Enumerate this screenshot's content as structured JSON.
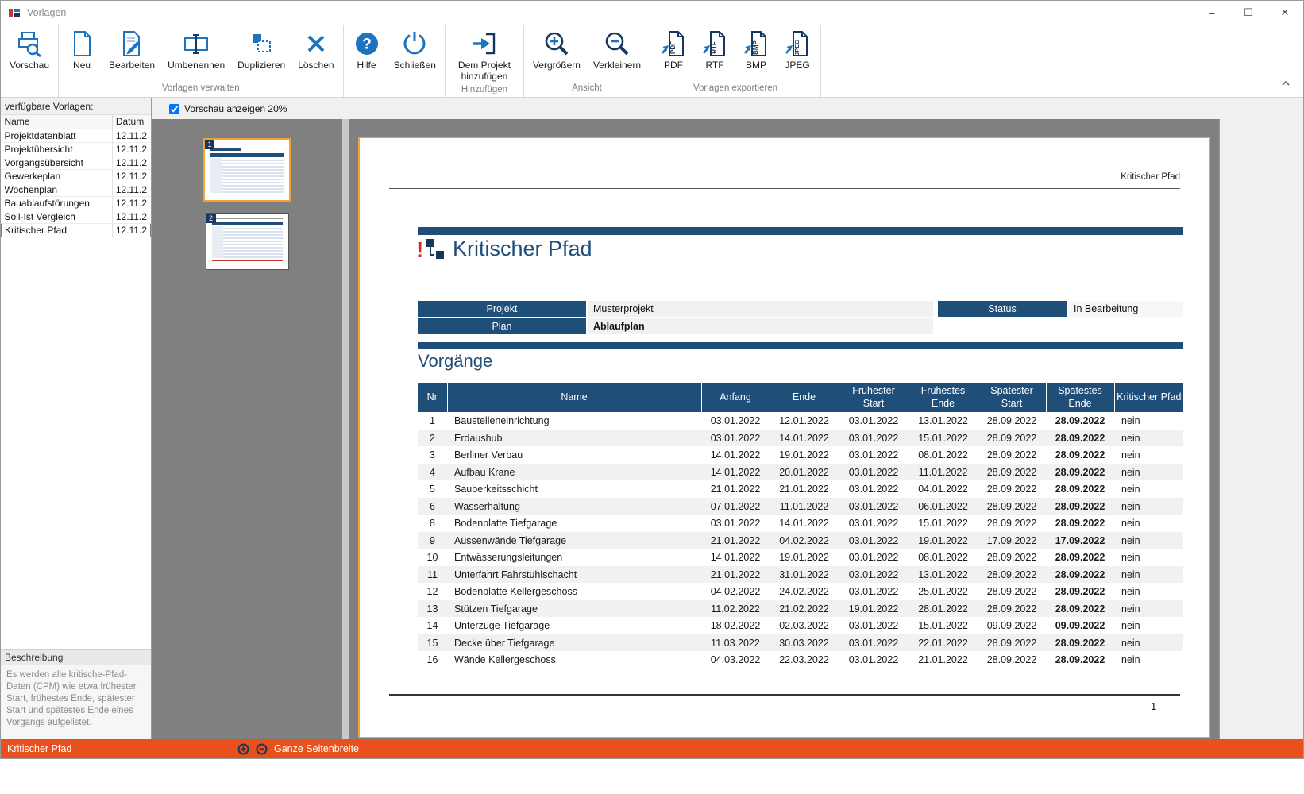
{
  "window": {
    "title": "Vorlagen",
    "minimize": "–",
    "maximize": "☐",
    "close": "✕"
  },
  "ribbon": {
    "labels": {
      "vorschau": "Vorschau",
      "neu": "Neu",
      "bearbeiten": "Bearbeiten",
      "umbenennen": "Umbenennen",
      "duplizieren": "Duplizieren",
      "loeschen": "Löschen",
      "hilfe": "Hilfe",
      "schliessen": "Schließen",
      "projekt_hinzufuegen": "Dem Projekt hinzufügen",
      "vergroessern": "Vergrößern",
      "verkleinern": "Verkleinern",
      "pdf": "PDF",
      "rtf": "RTF",
      "bmp": "BMP",
      "jpeg": "JPEG"
    },
    "groups": {
      "verwalten": "Vorlagen verwalten",
      "hinzufuegen": "Hinzufügen",
      "ansicht": "Ansicht",
      "exportieren": "Vorlagen exportieren"
    }
  },
  "sidebar": {
    "header": "verfügbare Vorlagen:",
    "col_name": "Name",
    "col_datum": "Datum",
    "items": [
      {
        "name": "Projektdatenblatt",
        "datum": "12.11.2"
      },
      {
        "name": "Projektübersicht",
        "datum": "12.11.2"
      },
      {
        "name": "Vorgangsübersicht",
        "datum": "12.11.2"
      },
      {
        "name": "Gewerkeplan",
        "datum": "12.11.2"
      },
      {
        "name": "Wochenplan",
        "datum": "12.11.2"
      },
      {
        "name": "Bauablaufstörungen",
        "datum": "12.11.2"
      },
      {
        "name": "Soll-Ist Vergleich",
        "datum": "12.11.2"
      },
      {
        "name": "Kritischer Pfad",
        "datum": "12.11.2",
        "selected": true
      }
    ],
    "description_header": "Beschreibung",
    "description": "Es werden alle kritische-Pfad-Daten (CPM) wie etwa frühester Start, frühestes Ende, spätester Start und spätestes Ende eines Vorgangs aufgelistet."
  },
  "preview_toolbar": {
    "checkbox_label": "Vorschau anzeigen 20%"
  },
  "thumbnails": [
    {
      "page": "1",
      "selected": true
    },
    {
      "page": "2",
      "selected": false
    }
  ],
  "report": {
    "header_right": "Kritischer Pfad",
    "title": "Kritischer Pfad",
    "info": {
      "projekt_label": "Projekt",
      "projekt_value": "Musterprojekt",
      "status_label": "Status",
      "status_value": "In Bearbeitung",
      "plan_label": "Plan",
      "plan_value": "Ablaufplan"
    },
    "section_title": "Vorgänge",
    "table": {
      "headers": [
        "Nr",
        "Name",
        "Anfang",
        "Ende",
        "Frühester Start",
        "Frühestes Ende",
        "Spätester Start",
        "Spätestes Ende",
        "Kritischer Pfad"
      ],
      "rows": [
        {
          "nr": "1",
          "name": "Baustelleneinrichtung",
          "anfang": "03.01.2022",
          "ende": "12.01.2022",
          "fr_start": "03.01.2022",
          "fr_ende": "13.01.2022",
          "sp_start": "28.09.2022",
          "sp_ende": "28.09.2022",
          "kritisch": "nein"
        },
        {
          "nr": "2",
          "name": "Erdaushub",
          "anfang": "03.01.2022",
          "ende": "14.01.2022",
          "fr_start": "03.01.2022",
          "fr_ende": "15.01.2022",
          "sp_start": "28.09.2022",
          "sp_ende": "28.09.2022",
          "kritisch": "nein"
        },
        {
          "nr": "3",
          "name": "Berliner Verbau",
          "anfang": "14.01.2022",
          "ende": "19.01.2022",
          "fr_start": "03.01.2022",
          "fr_ende": "08.01.2022",
          "sp_start": "28.09.2022",
          "sp_ende": "28.09.2022",
          "kritisch": "nein"
        },
        {
          "nr": "4",
          "name": "Aufbau Krane",
          "anfang": "14.01.2022",
          "ende": "20.01.2022",
          "fr_start": "03.01.2022",
          "fr_ende": "11.01.2022",
          "sp_start": "28.09.2022",
          "sp_ende": "28.09.2022",
          "kritisch": "nein"
        },
        {
          "nr": "5",
          "name": "Sauberkeitsschicht",
          "anfang": "21.01.2022",
          "ende": "21.01.2022",
          "fr_start": "03.01.2022",
          "fr_ende": "04.01.2022",
          "sp_start": "28.09.2022",
          "sp_ende": "28.09.2022",
          "kritisch": "nein"
        },
        {
          "nr": "6",
          "name": "Wasserhaltung",
          "anfang": "07.01.2022",
          "ende": "11.01.2022",
          "fr_start": "03.01.2022",
          "fr_ende": "06.01.2022",
          "sp_start": "28.09.2022",
          "sp_ende": "28.09.2022",
          "kritisch": "nein"
        },
        {
          "nr": "8",
          "name": "Bodenplatte Tiefgarage",
          "anfang": "03.01.2022",
          "ende": "14.01.2022",
          "fr_start": "03.01.2022",
          "fr_ende": "15.01.2022",
          "sp_start": "28.09.2022",
          "sp_ende": "28.09.2022",
          "kritisch": "nein"
        },
        {
          "nr": "9",
          "name": "Aussenwände Tiefgarage",
          "anfang": "21.01.2022",
          "ende": "04.02.2022",
          "fr_start": "03.01.2022",
          "fr_ende": "19.01.2022",
          "sp_start": "17.09.2022",
          "sp_ende": "17.09.2022",
          "kritisch": "nein"
        },
        {
          "nr": "10",
          "name": "Entwässerungsleitungen",
          "anfang": "14.01.2022",
          "ende": "19.01.2022",
          "fr_start": "03.01.2022",
          "fr_ende": "08.01.2022",
          "sp_start": "28.09.2022",
          "sp_ende": "28.09.2022",
          "kritisch": "nein"
        },
        {
          "nr": "11",
          "name": "Unterfahrt Fahrstuhlschacht",
          "anfang": "21.01.2022",
          "ende": "31.01.2022",
          "fr_start": "03.01.2022",
          "fr_ende": "13.01.2022",
          "sp_start": "28.09.2022",
          "sp_ende": "28.09.2022",
          "kritisch": "nein"
        },
        {
          "nr": "12",
          "name": "Bodenplatte Kellergeschoss",
          "anfang": "04.02.2022",
          "ende": "24.02.2022",
          "fr_start": "03.01.2022",
          "fr_ende": "25.01.2022",
          "sp_start": "28.09.2022",
          "sp_ende": "28.09.2022",
          "kritisch": "nein"
        },
        {
          "nr": "13",
          "name": "Stützen Tiefgarage",
          "anfang": "11.02.2022",
          "ende": "21.02.2022",
          "fr_start": "19.01.2022",
          "fr_ende": "28.01.2022",
          "sp_start": "28.09.2022",
          "sp_ende": "28.09.2022",
          "kritisch": "nein"
        },
        {
          "nr": "14",
          "name": "Unterzüge Tiefgarage",
          "anfang": "18.02.2022",
          "ende": "02.03.2022",
          "fr_start": "03.01.2022",
          "fr_ende": "15.01.2022",
          "sp_start": "09.09.2022",
          "sp_ende": "09.09.2022",
          "kritisch": "nein"
        },
        {
          "nr": "15",
          "name": "Decke über Tiefgarage",
          "anfang": "11.03.2022",
          "ende": "30.03.2022",
          "fr_start": "03.01.2022",
          "fr_ende": "22.01.2022",
          "sp_start": "28.09.2022",
          "sp_ende": "28.09.2022",
          "kritisch": "nein"
        },
        {
          "nr": "16",
          "name": "Wände Kellergeschoss",
          "anfang": "04.03.2022",
          "ende": "22.03.2022",
          "fr_start": "03.01.2022",
          "fr_ende": "21.01.2022",
          "sp_start": "28.09.2022",
          "sp_ende": "28.09.2022",
          "kritisch": "nein"
        }
      ]
    },
    "page_number": "1"
  },
  "statusbar": {
    "template_name": "Kritischer Pfad",
    "fit_label": "Ganze Seitenbreite"
  },
  "colors": {
    "navy": "#1F4E79",
    "accent_blue": "#1E73BE",
    "orange": "#E8511D",
    "selection": "#F0A335"
  }
}
